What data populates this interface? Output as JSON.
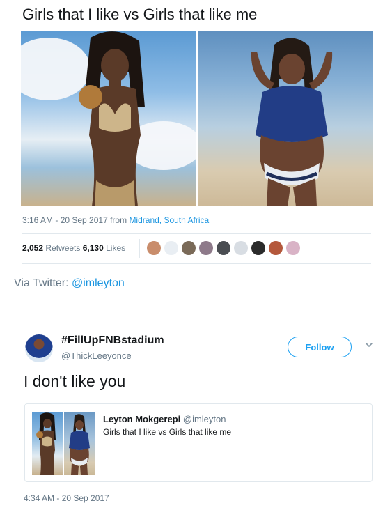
{
  "tweet1": {
    "text": "Girls that I like vs Girls  that like me",
    "time": "3:16 AM - 20 Sep 2017",
    "from_word": " from ",
    "location": "Midrand, South Africa",
    "retweets_count": "2,052",
    "retweets_label": " Retweets ",
    "likes_count": "6,130",
    "likes_label": " Likes",
    "liker_avatar_colors": [
      "#c98d6c",
      "#e9eef3",
      "#7a6a58",
      "#8e7a8a",
      "#4a4d52",
      "#d8dde3",
      "#2b2b2b",
      "#b4583c",
      "#d9b3c6"
    ]
  },
  "via": {
    "prefix": "Via Twitter: ",
    "handle": "@imleyton"
  },
  "tweet2": {
    "display_name": "#FillUpFNBstadium",
    "handle": "@ThickLeeyonce",
    "follow_label": "Follow",
    "text": "I don't like you",
    "time": "4:34 AM - 20 Sep 2017",
    "quoted": {
      "name": "Leyton Mokgerepi",
      "handle": "@imleyton",
      "text": "Girls that I like vs Girls  that like me"
    }
  },
  "colors": {
    "link": "#1b95e0",
    "follow": "#1da1f2",
    "secondary_text": "#657786",
    "divider": "#e1e8ed"
  }
}
